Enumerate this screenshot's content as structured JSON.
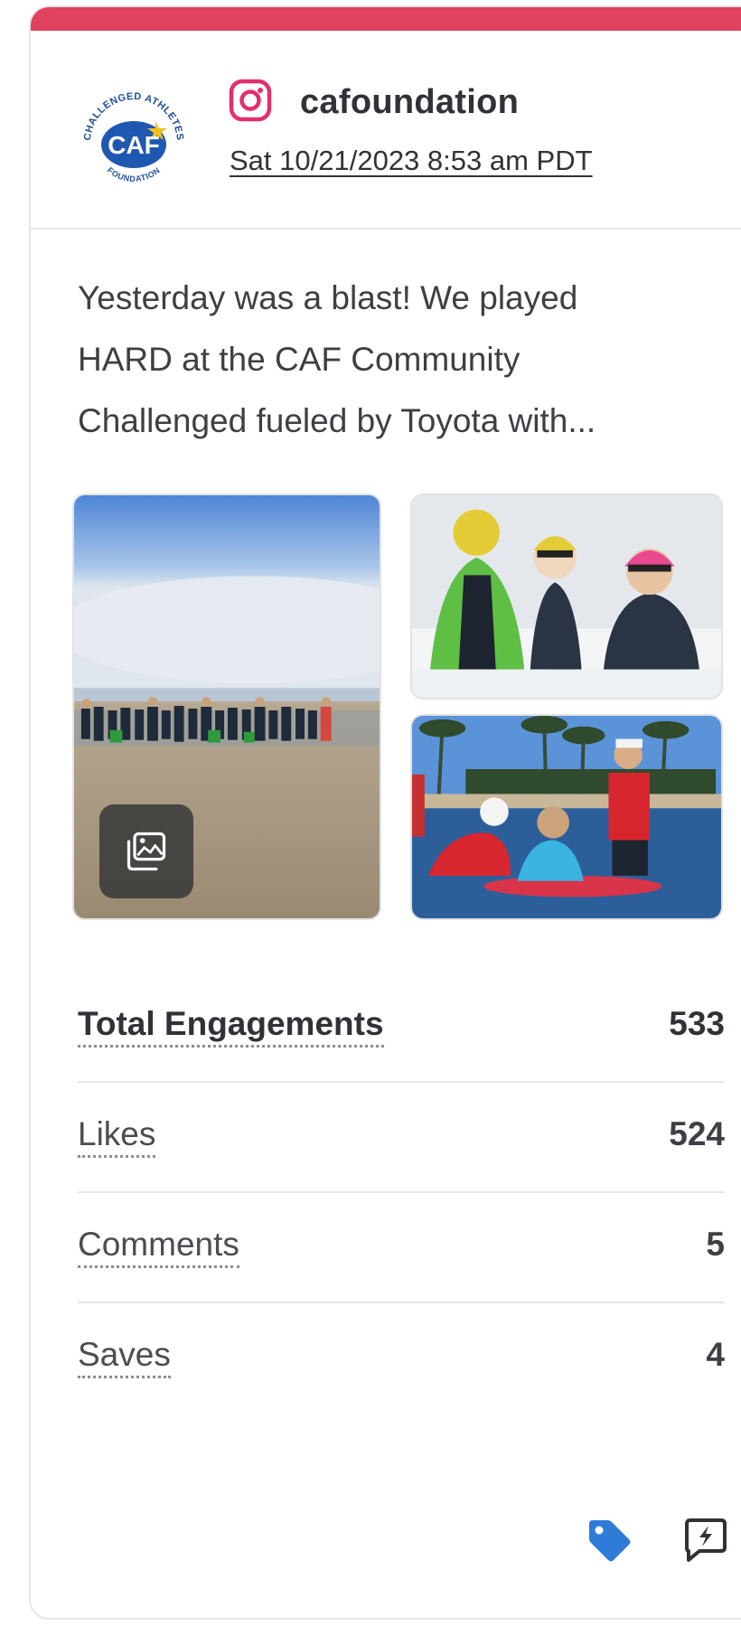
{
  "header": {
    "account_name": "cafoundation",
    "post_date": "Sat 10/21/2023 8:53 am PDT",
    "network": "instagram-icon",
    "logo": {
      "ring_top_text": "CHALLENGED ATHLETES",
      "ring_bottom_text": "FOUNDATION",
      "center_text": "CAF"
    }
  },
  "post": {
    "text_line_1": "Yesterday was a blast! We played",
    "text_line_2": "HARD at the CAF Community",
    "text_line_3": "Challenged fueled by Toyota with..."
  },
  "photos": [
    {
      "name": "group-beach-photo"
    },
    {
      "name": "swimmers-in-water-photo"
    },
    {
      "name": "kids-surfing-photo"
    }
  ],
  "metrics": [
    {
      "label": "Total Engagements",
      "value": "533"
    },
    {
      "label": "Likes",
      "value": "524"
    },
    {
      "label": "Comments",
      "value": "5"
    },
    {
      "label": "Saves",
      "value": "4"
    }
  ],
  "colors": {
    "accent": "#e0415f",
    "tag_icon": "#2f7bd8",
    "instagram": "#e1306c"
  }
}
